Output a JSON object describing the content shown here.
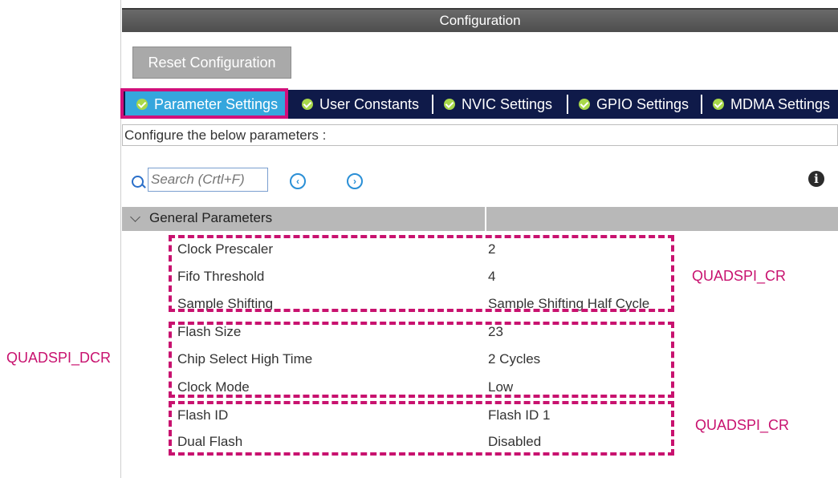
{
  "window": {
    "title": "Configuration"
  },
  "toolbar": {
    "reset_label": "Reset Configuration"
  },
  "tabs": [
    {
      "label": "Parameter Settings",
      "active": true
    },
    {
      "label": "User Constants"
    },
    {
      "label": "NVIC Settings"
    },
    {
      "label": "GPIO Settings"
    },
    {
      "label": "MDMA Settings"
    }
  ],
  "configure_text": "Configure the below parameters :",
  "search": {
    "placeholder": "Search (Crtl+F)"
  },
  "group": {
    "title": "General Parameters"
  },
  "params": [
    {
      "label": "Clock Prescaler",
      "value": "2"
    },
    {
      "label": "Fifo Threshold",
      "value": "4"
    },
    {
      "label": "Sample Shifting",
      "value": "Sample Shifting Half Cycle"
    },
    {
      "label": "Flash Size",
      "value": "23"
    },
    {
      "label": "Chip Select High Time",
      "value": "2 Cycles"
    },
    {
      "label": "Clock Mode",
      "value": "Low"
    },
    {
      "label": "Flash ID",
      "value": "Flash ID 1"
    },
    {
      "label": "Dual Flash",
      "value": "Disabled"
    }
  ],
  "annotations": {
    "cr_top": "QUADSPI_CR",
    "dcr": "QUADSPI_DCR",
    "cr_bottom": "QUADSPI_CR"
  },
  "colors": {
    "highlight": "#d10f7a",
    "tab_bar": "#0f1a49",
    "tab_active": "#35a6dd",
    "check": "#a8d84a"
  }
}
